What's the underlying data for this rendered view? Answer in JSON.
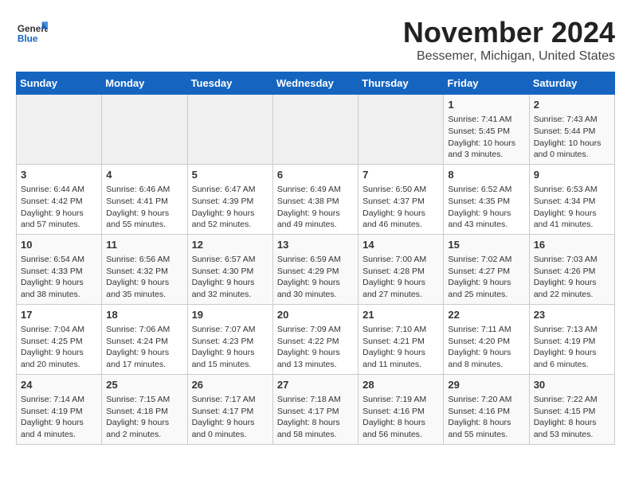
{
  "logo": {
    "general": "General",
    "blue": "Blue"
  },
  "header": {
    "month": "November 2024",
    "location": "Bessemer, Michigan, United States"
  },
  "weekdays": [
    "Sunday",
    "Monday",
    "Tuesday",
    "Wednesday",
    "Thursday",
    "Friday",
    "Saturday"
  ],
  "weeks": [
    [
      {
        "day": "",
        "empty": true
      },
      {
        "day": "",
        "empty": true
      },
      {
        "day": "",
        "empty": true
      },
      {
        "day": "",
        "empty": true
      },
      {
        "day": "",
        "empty": true
      },
      {
        "day": "1",
        "sunrise": "Sunrise: 7:41 AM",
        "sunset": "Sunset: 5:45 PM",
        "daylight": "Daylight: 10 hours and 3 minutes."
      },
      {
        "day": "2",
        "sunrise": "Sunrise: 7:43 AM",
        "sunset": "Sunset: 5:44 PM",
        "daylight": "Daylight: 10 hours and 0 minutes."
      }
    ],
    [
      {
        "day": "3",
        "sunrise": "Sunrise: 6:44 AM",
        "sunset": "Sunset: 4:42 PM",
        "daylight": "Daylight: 9 hours and 57 minutes."
      },
      {
        "day": "4",
        "sunrise": "Sunrise: 6:46 AM",
        "sunset": "Sunset: 4:41 PM",
        "daylight": "Daylight: 9 hours and 55 minutes."
      },
      {
        "day": "5",
        "sunrise": "Sunrise: 6:47 AM",
        "sunset": "Sunset: 4:39 PM",
        "daylight": "Daylight: 9 hours and 52 minutes."
      },
      {
        "day": "6",
        "sunrise": "Sunrise: 6:49 AM",
        "sunset": "Sunset: 4:38 PM",
        "daylight": "Daylight: 9 hours and 49 minutes."
      },
      {
        "day": "7",
        "sunrise": "Sunrise: 6:50 AM",
        "sunset": "Sunset: 4:37 PM",
        "daylight": "Daylight: 9 hours and 46 minutes."
      },
      {
        "day": "8",
        "sunrise": "Sunrise: 6:52 AM",
        "sunset": "Sunset: 4:35 PM",
        "daylight": "Daylight: 9 hours and 43 minutes."
      },
      {
        "day": "9",
        "sunrise": "Sunrise: 6:53 AM",
        "sunset": "Sunset: 4:34 PM",
        "daylight": "Daylight: 9 hours and 41 minutes."
      }
    ],
    [
      {
        "day": "10",
        "sunrise": "Sunrise: 6:54 AM",
        "sunset": "Sunset: 4:33 PM",
        "daylight": "Daylight: 9 hours and 38 minutes."
      },
      {
        "day": "11",
        "sunrise": "Sunrise: 6:56 AM",
        "sunset": "Sunset: 4:32 PM",
        "daylight": "Daylight: 9 hours and 35 minutes."
      },
      {
        "day": "12",
        "sunrise": "Sunrise: 6:57 AM",
        "sunset": "Sunset: 4:30 PM",
        "daylight": "Daylight: 9 hours and 32 minutes."
      },
      {
        "day": "13",
        "sunrise": "Sunrise: 6:59 AM",
        "sunset": "Sunset: 4:29 PM",
        "daylight": "Daylight: 9 hours and 30 minutes."
      },
      {
        "day": "14",
        "sunrise": "Sunrise: 7:00 AM",
        "sunset": "Sunset: 4:28 PM",
        "daylight": "Daylight: 9 hours and 27 minutes."
      },
      {
        "day": "15",
        "sunrise": "Sunrise: 7:02 AM",
        "sunset": "Sunset: 4:27 PM",
        "daylight": "Daylight: 9 hours and 25 minutes."
      },
      {
        "day": "16",
        "sunrise": "Sunrise: 7:03 AM",
        "sunset": "Sunset: 4:26 PM",
        "daylight": "Daylight: 9 hours and 22 minutes."
      }
    ],
    [
      {
        "day": "17",
        "sunrise": "Sunrise: 7:04 AM",
        "sunset": "Sunset: 4:25 PM",
        "daylight": "Daylight: 9 hours and 20 minutes."
      },
      {
        "day": "18",
        "sunrise": "Sunrise: 7:06 AM",
        "sunset": "Sunset: 4:24 PM",
        "daylight": "Daylight: 9 hours and 17 minutes."
      },
      {
        "day": "19",
        "sunrise": "Sunrise: 7:07 AM",
        "sunset": "Sunset: 4:23 PM",
        "daylight": "Daylight: 9 hours and 15 minutes."
      },
      {
        "day": "20",
        "sunrise": "Sunrise: 7:09 AM",
        "sunset": "Sunset: 4:22 PM",
        "daylight": "Daylight: 9 hours and 13 minutes."
      },
      {
        "day": "21",
        "sunrise": "Sunrise: 7:10 AM",
        "sunset": "Sunset: 4:21 PM",
        "daylight": "Daylight: 9 hours and 11 minutes."
      },
      {
        "day": "22",
        "sunrise": "Sunrise: 7:11 AM",
        "sunset": "Sunset: 4:20 PM",
        "daylight": "Daylight: 9 hours and 8 minutes."
      },
      {
        "day": "23",
        "sunrise": "Sunrise: 7:13 AM",
        "sunset": "Sunset: 4:19 PM",
        "daylight": "Daylight: 9 hours and 6 minutes."
      }
    ],
    [
      {
        "day": "24",
        "sunrise": "Sunrise: 7:14 AM",
        "sunset": "Sunset: 4:19 PM",
        "daylight": "Daylight: 9 hours and 4 minutes."
      },
      {
        "day": "25",
        "sunrise": "Sunrise: 7:15 AM",
        "sunset": "Sunset: 4:18 PM",
        "daylight": "Daylight: 9 hours and 2 minutes."
      },
      {
        "day": "26",
        "sunrise": "Sunrise: 7:17 AM",
        "sunset": "Sunset: 4:17 PM",
        "daylight": "Daylight: 9 hours and 0 minutes."
      },
      {
        "day": "27",
        "sunrise": "Sunrise: 7:18 AM",
        "sunset": "Sunset: 4:17 PM",
        "daylight": "Daylight: 8 hours and 58 minutes."
      },
      {
        "day": "28",
        "sunrise": "Sunrise: 7:19 AM",
        "sunset": "Sunset: 4:16 PM",
        "daylight": "Daylight: 8 hours and 56 minutes."
      },
      {
        "day": "29",
        "sunrise": "Sunrise: 7:20 AM",
        "sunset": "Sunset: 4:16 PM",
        "daylight": "Daylight: 8 hours and 55 minutes."
      },
      {
        "day": "30",
        "sunrise": "Sunrise: 7:22 AM",
        "sunset": "Sunset: 4:15 PM",
        "daylight": "Daylight: 8 hours and 53 minutes."
      }
    ]
  ]
}
